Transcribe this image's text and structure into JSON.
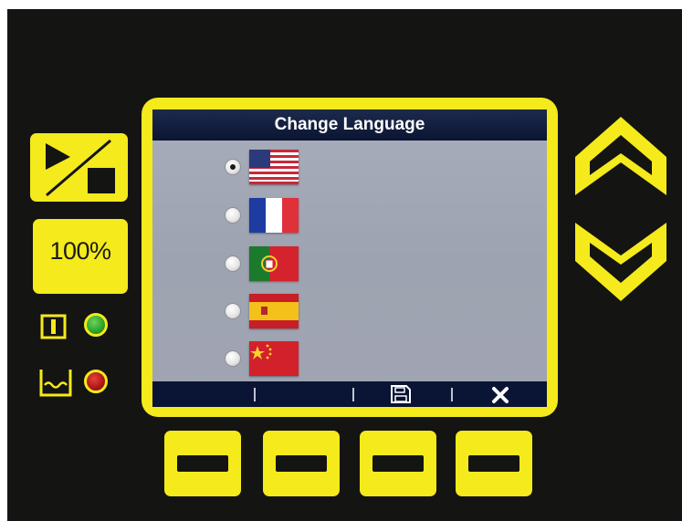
{
  "screen": {
    "title": "Change Language",
    "languages": [
      {
        "flag": "united-states-flag",
        "selected": true
      },
      {
        "flag": "france-flag",
        "selected": false
      },
      {
        "flag": "portugal-flag",
        "selected": false
      },
      {
        "flag": "spain-flag",
        "selected": false
      },
      {
        "flag": "china-flag",
        "selected": false
      }
    ],
    "softkeys": [
      {
        "icon": "blank"
      },
      {
        "icon": "blank"
      },
      {
        "icon": "save-icon"
      },
      {
        "icon": "close-icon"
      }
    ]
  },
  "left_panel": {
    "play_stop_icon": "play-stop-icon",
    "percent_label": "100%",
    "indicators": [
      {
        "icon": "power-icon",
        "led_color": "#2fa82b"
      },
      {
        "icon": "tank-icon",
        "led_color": "#b3171a"
      }
    ]
  },
  "right_panel": {
    "up_icon": "chevron-up-icon",
    "down_icon": "chevron-down-icon"
  },
  "colors": {
    "accent": "#f4ea1c",
    "panel": "#141413",
    "screen_bg": "#a3a8b6",
    "title_bg": "#0b1532"
  }
}
